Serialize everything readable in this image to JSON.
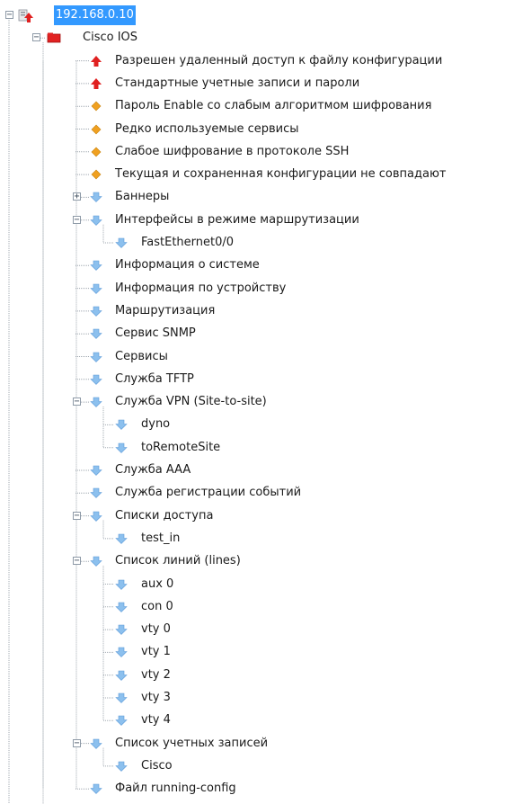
{
  "colors": {
    "selection": "#3399ff",
    "severity_high": "#e02020",
    "severity_medium": "#f0a020",
    "info_arrow": "#8cc0ee",
    "tree_line": "#a0a8b0"
  },
  "tree": [
    {
      "label": "192.168.0.10",
      "icon": "host-alert-icon",
      "level": 0,
      "expander": "minus",
      "selected": true
    },
    {
      "label": "Cisco IOS",
      "icon": "cisco-folder-icon",
      "level": 1,
      "expander": "minus"
    },
    {
      "label": "Разрешен удаленный доступ к файлу конфигурации",
      "icon": "high-severity-icon",
      "level": 2
    },
    {
      "label": "Стандартные учетные записи и пароли",
      "icon": "high-severity-icon",
      "level": 2
    },
    {
      "label": "Пароль Enable со слабым алгоритмом шифрования",
      "icon": "medium-severity-icon",
      "level": 2
    },
    {
      "label": "Редко используемые сервисы",
      "icon": "medium-severity-icon",
      "level": 2
    },
    {
      "label": "Слабое шифрование в протоколе SSH",
      "icon": "medium-severity-icon",
      "level": 2
    },
    {
      "label": "Текущая и сохраненная конфигурации не совпадают",
      "icon": "medium-severity-icon",
      "level": 2
    },
    {
      "label": "Баннеры",
      "icon": "info-arrow-icon",
      "level": 2,
      "expander": "plus"
    },
    {
      "label": "Интерфейсы в режиме маршрутизации",
      "icon": "info-arrow-icon",
      "level": 2,
      "expander": "minus"
    },
    {
      "label": "FastEthernet0/0",
      "icon": "info-arrow-icon",
      "level": 3
    },
    {
      "label": "Информация о системе",
      "icon": "info-arrow-icon",
      "level": 2
    },
    {
      "label": "Информация по устройству",
      "icon": "info-arrow-icon",
      "level": 2
    },
    {
      "label": "Маршрутизация",
      "icon": "info-arrow-icon",
      "level": 2
    },
    {
      "label": "Сервис SNMP",
      "icon": "info-arrow-icon",
      "level": 2
    },
    {
      "label": "Сервисы",
      "icon": "info-arrow-icon",
      "level": 2
    },
    {
      "label": "Служба TFTP",
      "icon": "info-arrow-icon",
      "level": 2
    },
    {
      "label": "Служба VPN (Site-to-site)",
      "icon": "info-arrow-icon",
      "level": 2,
      "expander": "minus"
    },
    {
      "label": "dyno",
      "icon": "info-arrow-icon",
      "level": 3
    },
    {
      "label": "toRemoteSite",
      "icon": "info-arrow-icon",
      "level": 3
    },
    {
      "label": "Служба AAA",
      "icon": "info-arrow-icon",
      "level": 2
    },
    {
      "label": "Служба регистрации событий",
      "icon": "info-arrow-icon",
      "level": 2
    },
    {
      "label": "Списки доступа",
      "icon": "info-arrow-icon",
      "level": 2,
      "expander": "minus"
    },
    {
      "label": "test_in",
      "icon": "info-arrow-icon",
      "level": 3
    },
    {
      "label": "Список линий (lines)",
      "icon": "info-arrow-icon",
      "level": 2,
      "expander": "minus"
    },
    {
      "label": "aux 0",
      "icon": "info-arrow-icon",
      "level": 3
    },
    {
      "label": "con 0",
      "icon": "info-arrow-icon",
      "level": 3
    },
    {
      "label": "vty 0",
      "icon": "info-arrow-icon",
      "level": 3
    },
    {
      "label": "vty 1",
      "icon": "info-arrow-icon",
      "level": 3
    },
    {
      "label": "vty 2",
      "icon": "info-arrow-icon",
      "level": 3
    },
    {
      "label": "vty 3",
      "icon": "info-arrow-icon",
      "level": 3
    },
    {
      "label": "vty 4",
      "icon": "info-arrow-icon",
      "level": 3
    },
    {
      "label": "Список учетных записей",
      "icon": "info-arrow-icon",
      "level": 2,
      "expander": "minus"
    },
    {
      "label": "Cisco",
      "icon": "info-arrow-icon",
      "level": 3
    },
    {
      "label": "Файл running-config",
      "icon": "info-arrow-icon",
      "level": 2
    }
  ]
}
